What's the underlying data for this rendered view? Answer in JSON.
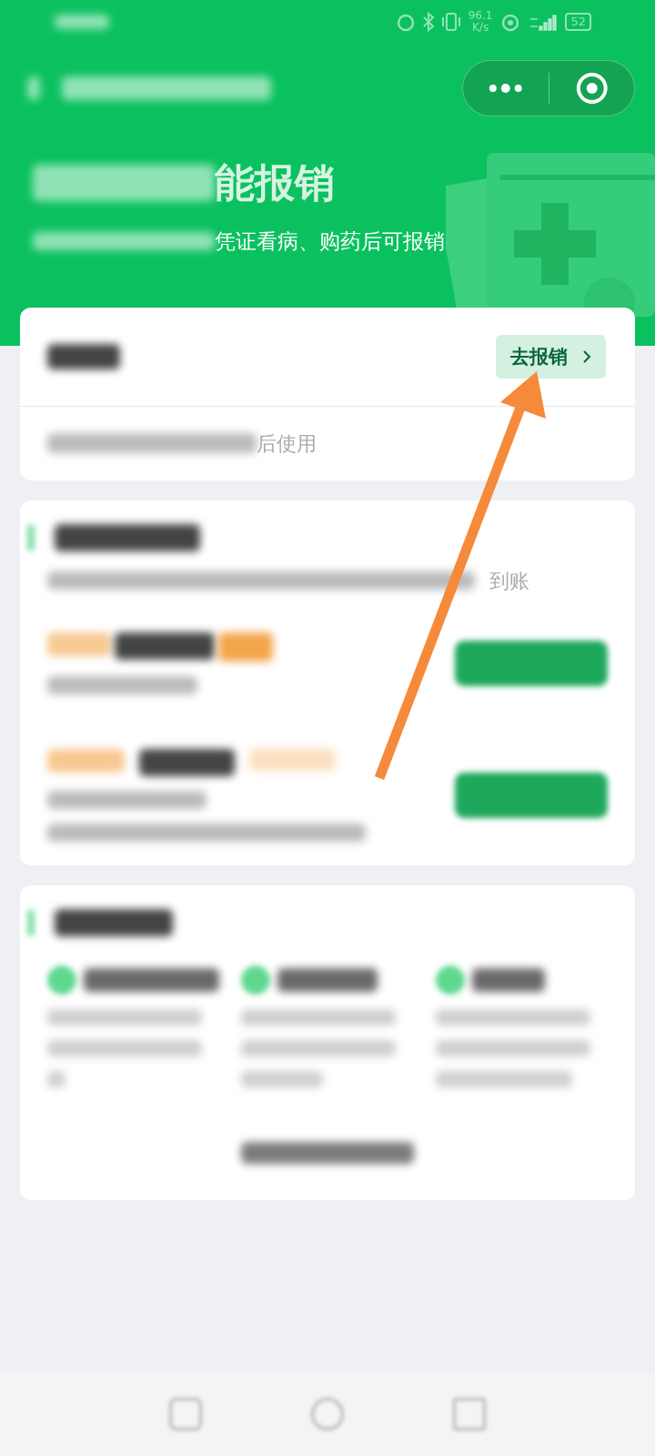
{
  "status_bar": {
    "network_speed": "96.1",
    "network_unit": "K/s",
    "battery": "52"
  },
  "header": {
    "title_visible": "能报销",
    "subtitle_visible": "凭证看病、购药后可报销"
  },
  "claim_card": {
    "button": "去报销",
    "note_visible": "后使用"
  },
  "fund_card": {
    "subtitle_visible": "到账"
  }
}
